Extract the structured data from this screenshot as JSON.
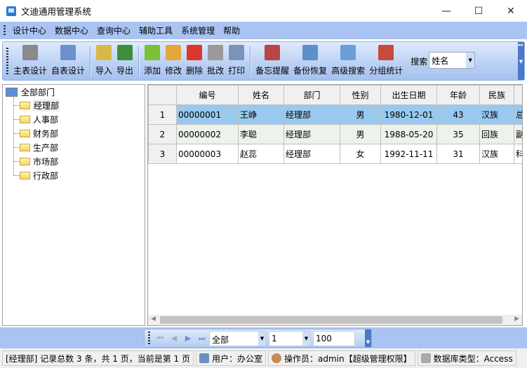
{
  "window": {
    "title": "文迪通用管理系统",
    "minimize": "—",
    "maximize": "☐",
    "close": "✕"
  },
  "menu": [
    "设计中心",
    "数据中心",
    "查询中心",
    "辅助工具",
    "系统管理",
    "帮助"
  ],
  "toolbar": {
    "groups": [
      [
        {
          "label": "主表设计",
          "icon": "database-icon",
          "color": "#8a8a8a"
        },
        {
          "label": "自表设计",
          "icon": "calendar-grid-icon",
          "color": "#6c8fd0"
        }
      ],
      [
        {
          "label": "导入",
          "icon": "folder-excel-import-icon",
          "color": "#d9b84a"
        },
        {
          "label": "导出",
          "icon": "excel-export-icon",
          "color": "#3d8f3d"
        }
      ],
      [
        {
          "label": "添加",
          "icon": "add-document-icon",
          "color": "#7cc03a"
        },
        {
          "label": "修改",
          "icon": "pencil-icon",
          "color": "#e7a53a"
        },
        {
          "label": "删除",
          "icon": "delete-icon",
          "color": "#d9382b"
        },
        {
          "label": "批改",
          "icon": "batch-edit-icon",
          "color": "#9a9a9a"
        },
        {
          "label": "打印",
          "icon": "printer-icon",
          "color": "#7a93b8"
        }
      ],
      [
        {
          "label": "备忘提醒",
          "icon": "calendar-clock-icon",
          "color": "#b44"
        },
        {
          "label": "备份恢复",
          "icon": "floppy-disk-icon",
          "color": "#5f8fc8"
        },
        {
          "label": "高级搜索",
          "icon": "search-window-icon",
          "color": "#6aa0d8"
        },
        {
          "label": "分组统计",
          "icon": "books-icon",
          "color": "#c84a3a"
        }
      ]
    ],
    "search_label": "搜索",
    "search_value": "姓名"
  },
  "tree": {
    "root": "全部部门",
    "children": [
      "经理部",
      "人事部",
      "财务部",
      "生产部",
      "市场部",
      "行政部"
    ],
    "selected": "经理部"
  },
  "grid": {
    "columns": [
      "编号",
      "姓名",
      "部门",
      "性别",
      "出生日期",
      "年龄",
      "民族",
      ""
    ],
    "rows": [
      [
        "1",
        "00000001",
        "王峥",
        "经理部",
        "男",
        "1980-12-01",
        "43",
        "汉族",
        "总"
      ],
      [
        "2",
        "00000002",
        "李聪",
        "经理部",
        "男",
        "1988-05-20",
        "35",
        "回族",
        "副"
      ],
      [
        "3",
        "00000003",
        "赵蕊",
        "经理部",
        "女",
        "1992-11-11",
        "31",
        "汉族",
        "科"
      ]
    ],
    "selected_row": 1
  },
  "navigator": {
    "scope": "全部",
    "page": "1",
    "page_size": "100"
  },
  "status": {
    "records": "[经理部] 记录总数 3 条，共 1 页，当前是第 1 页",
    "user": "用户：办公室",
    "operator": "操作员：admin【超级管理权限】",
    "dbtype": "数据库类型：Access"
  }
}
